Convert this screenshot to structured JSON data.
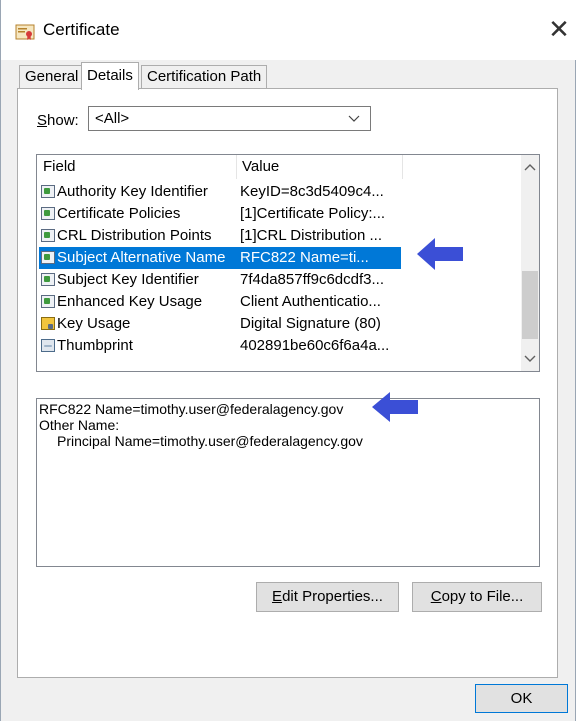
{
  "window": {
    "title": "Certificate",
    "close_glyph": "✕"
  },
  "tabs": [
    {
      "label": "General",
      "active": false
    },
    {
      "label": "Details",
      "active": true
    },
    {
      "label": "Certification Path",
      "active": false
    }
  ],
  "show": {
    "label_pre": "",
    "label_accel": "S",
    "label_post": "how:",
    "selected": "<All>"
  },
  "field_list": {
    "columns": [
      "Field",
      "Value"
    ],
    "rows": [
      {
        "field": "Authority Key Identifier",
        "value": "KeyID=8c3d5409c4...",
        "icon": "cert-field-icon",
        "selected": false
      },
      {
        "field": "Certificate Policies",
        "value": "[1]Certificate Policy:...",
        "icon": "cert-field-icon",
        "selected": false
      },
      {
        "field": "CRL Distribution Points",
        "value": "[1]CRL Distribution ...",
        "icon": "cert-field-icon",
        "selected": false
      },
      {
        "field": "Subject Alternative Name",
        "value": "RFC822 Name=ti...",
        "icon": "cert-field-icon",
        "selected": true
      },
      {
        "field": "Subject Key Identifier",
        "value": "7f4da857ff9c6dcdf3...",
        "icon": "cert-field-icon",
        "selected": false
      },
      {
        "field": "Enhanced Key Usage",
        "value": "Client Authenticatio...",
        "icon": "cert-field-icon",
        "selected": false
      },
      {
        "field": "Key Usage",
        "value": "Digital Signature (80)",
        "icon": "key-usage-icon",
        "selected": false
      },
      {
        "field": "Thumbprint",
        "value": "402891be60c6f6a4a...",
        "icon": "thumbprint-icon",
        "selected": false
      }
    ]
  },
  "details": {
    "line1": "RFC822 Name=timothy.user@federalagency.gov",
    "line2": "Other Name:",
    "line3": "Principal Name=timothy.user@federalagency.gov"
  },
  "buttons": {
    "edit_pre": "",
    "edit_accel": "E",
    "edit_post": "dit Properties...",
    "copy_pre": "",
    "copy_accel": "C",
    "copy_post": "opy to File...",
    "ok": "OK"
  },
  "colors": {
    "selection": "#0078d7",
    "annotation_arrow": "#3b4fd6"
  }
}
